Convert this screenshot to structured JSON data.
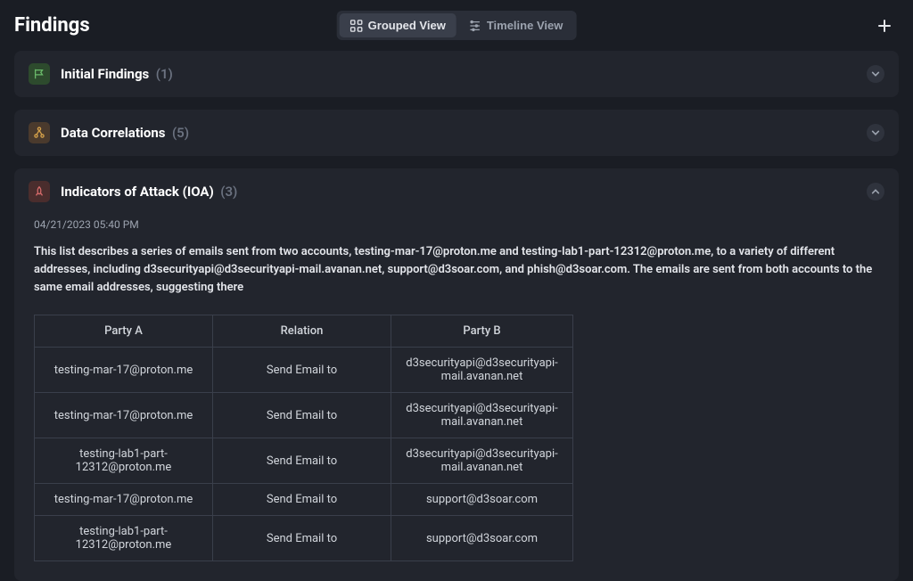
{
  "header": {
    "title": "Findings",
    "view_toggle": {
      "grouped": "Grouped View",
      "timeline": "Timeline View"
    }
  },
  "sections": {
    "initial": {
      "title": "Initial Findings",
      "count": "(1)"
    },
    "correlations": {
      "title": "Data Correlations",
      "count": "(5)"
    },
    "ioa": {
      "title": "Indicators of Attack (IOA)",
      "count": "(3)",
      "timestamp": "04/21/2023 05:40 PM",
      "description": "This list describes a series of emails sent from two accounts, testing-mar-17@proton.me and testing-lab1-part-12312@proton.me, to a variety of different addresses, including d3securityapi@d3securityapi-mail.avanan.net, support@d3soar.com, and phish@d3soar.com. The emails are sent from both accounts to the same email addresses, suggesting there",
      "table": {
        "headers": {
          "party_a": "Party A",
          "relation": "Relation",
          "party_b": "Party B"
        },
        "rows": [
          {
            "a": "testing-mar-17@proton.me",
            "rel": "Send Email to",
            "b": "d3securityapi@d3securityapi-mail.avanan.net"
          },
          {
            "a": "testing-mar-17@proton.me",
            "rel": "Send Email to",
            "b": "d3securityapi@d3securityapi-mail.avanan.net"
          },
          {
            "a": "testing-lab1-part-12312@proton.me",
            "rel": "Send Email to",
            "b": "d3securityapi@d3securityapi-mail.avanan.net"
          },
          {
            "a": "testing-mar-17@proton.me",
            "rel": "Send Email to",
            "b": "support@d3soar.com"
          },
          {
            "a": "testing-lab1-part-12312@proton.me",
            "rel": "Send Email to",
            "b": "support@d3soar.com"
          }
        ]
      }
    }
  }
}
